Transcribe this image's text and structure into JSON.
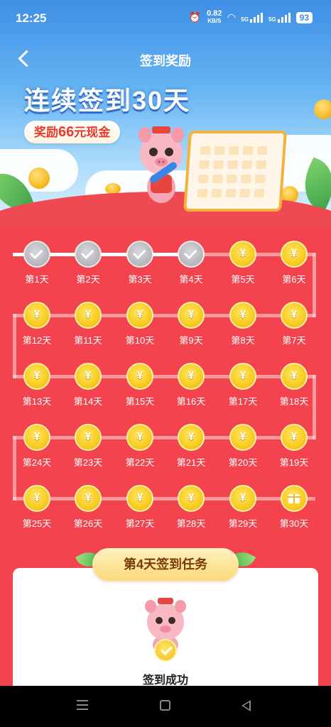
{
  "status": {
    "time": "12:25",
    "net_speed": "0.82",
    "net_unit": "KB/S",
    "sig1": "5G",
    "sig2": "5G",
    "battery": "93"
  },
  "nav": {
    "title": "签到奖励"
  },
  "banner": {
    "headline": "连续签到30天",
    "reward_prefix": "奖励",
    "reward_amount": "66",
    "reward_suffix": "元现金"
  },
  "coin_symbol": "¥",
  "days": [
    {
      "label": "第1天",
      "state": "checked"
    },
    {
      "label": "第2天",
      "state": "checked"
    },
    {
      "label": "第3天",
      "state": "checked"
    },
    {
      "label": "第4天",
      "state": "checked"
    },
    {
      "label": "第5天",
      "state": "coin"
    },
    {
      "label": "第6天",
      "state": "coin"
    },
    {
      "label": "第7天",
      "state": "coin"
    },
    {
      "label": "第8天",
      "state": "coin"
    },
    {
      "label": "第9天",
      "state": "coin"
    },
    {
      "label": "第10天",
      "state": "coin"
    },
    {
      "label": "第11天",
      "state": "coin"
    },
    {
      "label": "第12天",
      "state": "coin"
    },
    {
      "label": "第13天",
      "state": "coin"
    },
    {
      "label": "第14天",
      "state": "coin"
    },
    {
      "label": "第15天",
      "state": "coin"
    },
    {
      "label": "第16天",
      "state": "coin"
    },
    {
      "label": "第17天",
      "state": "coin"
    },
    {
      "label": "第18天",
      "state": "coin"
    },
    {
      "label": "第19天",
      "state": "coin"
    },
    {
      "label": "第20天",
      "state": "coin"
    },
    {
      "label": "第21天",
      "state": "coin"
    },
    {
      "label": "第22天",
      "state": "coin"
    },
    {
      "label": "第23天",
      "state": "coin"
    },
    {
      "label": "第24天",
      "state": "coin"
    },
    {
      "label": "第25天",
      "state": "coin"
    },
    {
      "label": "第26天",
      "state": "coin"
    },
    {
      "label": "第27天",
      "state": "coin"
    },
    {
      "label": "第28天",
      "state": "coin"
    },
    {
      "label": "第29天",
      "state": "coin"
    },
    {
      "label": "第30天",
      "state": "gift"
    }
  ],
  "task": {
    "title": "第4天签到任务",
    "status_text": "签到成功"
  }
}
